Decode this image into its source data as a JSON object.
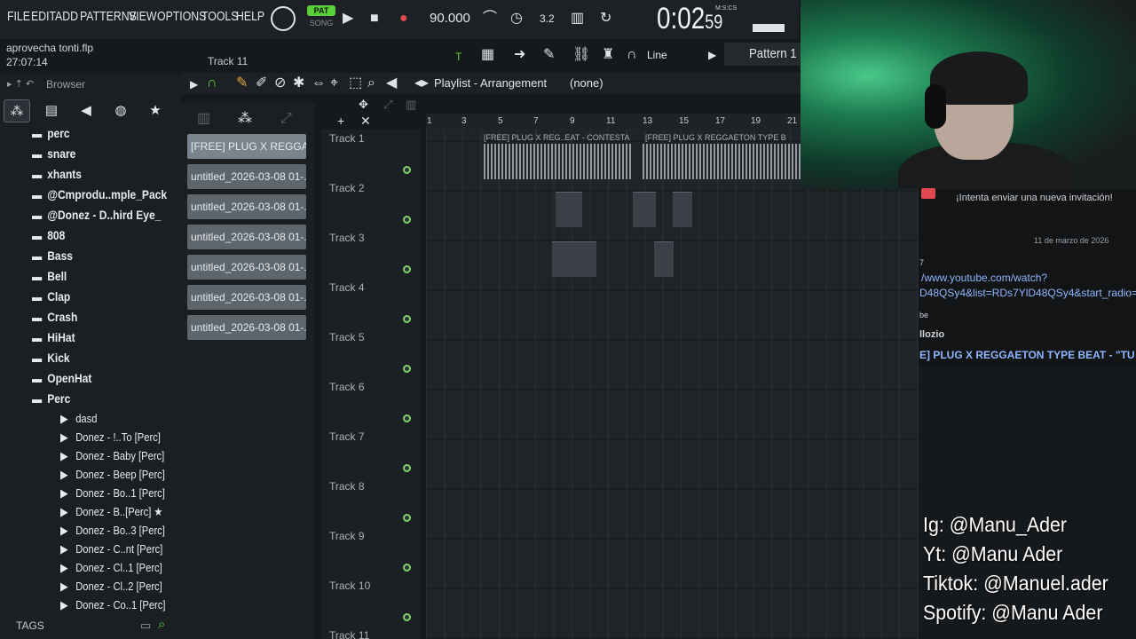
{
  "menubar": {
    "items": [
      "FILE",
      "EDIT",
      "ADD",
      "PATTERNS",
      "VIEW",
      "OPTIONS",
      "TOOLS",
      "HELP"
    ],
    "pat_label": "PAT",
    "song_label": "SONG",
    "tempo": "90.000",
    "time": "0:02",
    "time_sub": "59",
    "time_units": "M:S:CS"
  },
  "hint": {
    "line1": "aprovecha tonti.flp",
    "line2": "27:07:14"
  },
  "toolbar2": {
    "track_label": "Track 11",
    "snap_label": "Line",
    "pattern_label": "Pattern 1"
  },
  "browser": {
    "title": "Browser",
    "tags_label": "TAGS",
    "tree": [
      {
        "label": "perc",
        "indent": 1,
        "type": "folder"
      },
      {
        "label": "snare",
        "indent": 1,
        "type": "folder"
      },
      {
        "label": "xhants",
        "indent": 1,
        "type": "folder"
      },
      {
        "label": "@Cmprodu..mple_Pack",
        "indent": 0,
        "type": "folder"
      },
      {
        "label": "@Donez - D..hird Eye_",
        "indent": 0,
        "type": "folder"
      },
      {
        "label": "808",
        "indent": 1,
        "type": "folder"
      },
      {
        "label": "Bass",
        "indent": 1,
        "type": "folder"
      },
      {
        "label": "Bell",
        "indent": 1,
        "type": "folder"
      },
      {
        "label": "Clap",
        "indent": 1,
        "type": "folder"
      },
      {
        "label": "Crash",
        "indent": 1,
        "type": "folder"
      },
      {
        "label": "HiHat",
        "indent": 1,
        "type": "folder"
      },
      {
        "label": "Kick",
        "indent": 1,
        "type": "folder"
      },
      {
        "label": "OpenHat",
        "indent": 1,
        "type": "folder"
      },
      {
        "label": "Perc",
        "indent": 1,
        "type": "folder"
      },
      {
        "label": "dasd",
        "indent": 2,
        "type": "file"
      },
      {
        "label": "Donez - !..To [Perc]",
        "indent": 2,
        "type": "file"
      },
      {
        "label": "Donez - Baby [Perc]",
        "indent": 2,
        "type": "file"
      },
      {
        "label": "Donez - Beep [Perc]",
        "indent": 2,
        "type": "file"
      },
      {
        "label": "Donez - Bo..1 [Perc]",
        "indent": 2,
        "type": "file"
      },
      {
        "label": "Donez - B..[Perc] ★",
        "indent": 2,
        "type": "file"
      },
      {
        "label": "Donez - Bo..3 [Perc]",
        "indent": 2,
        "type": "file"
      },
      {
        "label": "Donez - C..nt [Perc]",
        "indent": 2,
        "type": "file"
      },
      {
        "label": "Donez - Cl..1 [Perc]",
        "indent": 2,
        "type": "file"
      },
      {
        "label": "Donez - Cl..2 [Perc]",
        "indent": 2,
        "type": "file"
      },
      {
        "label": "Donez - Co..1 [Perc]",
        "indent": 2,
        "type": "file"
      }
    ]
  },
  "picker": {
    "items": [
      "[FREE] PLUG X REGGA...",
      "untitled_2026-03-08 01-...",
      "untitled_2026-03-08 01-...",
      "untitled_2026-03-08 01-...",
      "untitled_2026-03-08 01-...",
      "untitled_2026-03-08 01-...",
      "untitled_2026-03-08 01-..."
    ]
  },
  "playlist": {
    "title": "Playlist - Arrangement",
    "pattern": "(none)",
    "ticks": [
      "1",
      "3",
      "5",
      "7",
      "9",
      "11",
      "13",
      "15",
      "17",
      "19",
      "21"
    ],
    "tracks": [
      "Track 1",
      "Track 2",
      "Track 3",
      "Track 4",
      "Track 5",
      "Track 6",
      "Track 7",
      "Track 8",
      "Track 9",
      "Track 10",
      "Track 11"
    ],
    "clip_labels": [
      "[FREE] PLUG X REG..EAT - CONTESTA",
      "[FREE] PLUG X REGGAETON TYPE B"
    ]
  },
  "chat": {
    "invite": "¡Intenta enviar una nueva invitación!",
    "date": "11 de marzo de 2026",
    "num": "7",
    "link1": "/www.youtube.com/watch?",
    "link2": "D48QSy4&list=RDs7YlD48QSy4&start_radio=",
    "be": "be",
    "user": "llozio",
    "title": "E] PLUG X REGGAETON TYPE BEAT - \"TU E"
  },
  "socials": [
    "Ig: @Manu_Ader",
    "Yt: @Manu Ader",
    "Tiktok: @Manuel.ader",
    "Spotify: @Manu Ader"
  ],
  "colors": {
    "accent_green": "#5bcf3b",
    "record_red": "#e0484f",
    "link_blue": "#8fb6ff"
  }
}
